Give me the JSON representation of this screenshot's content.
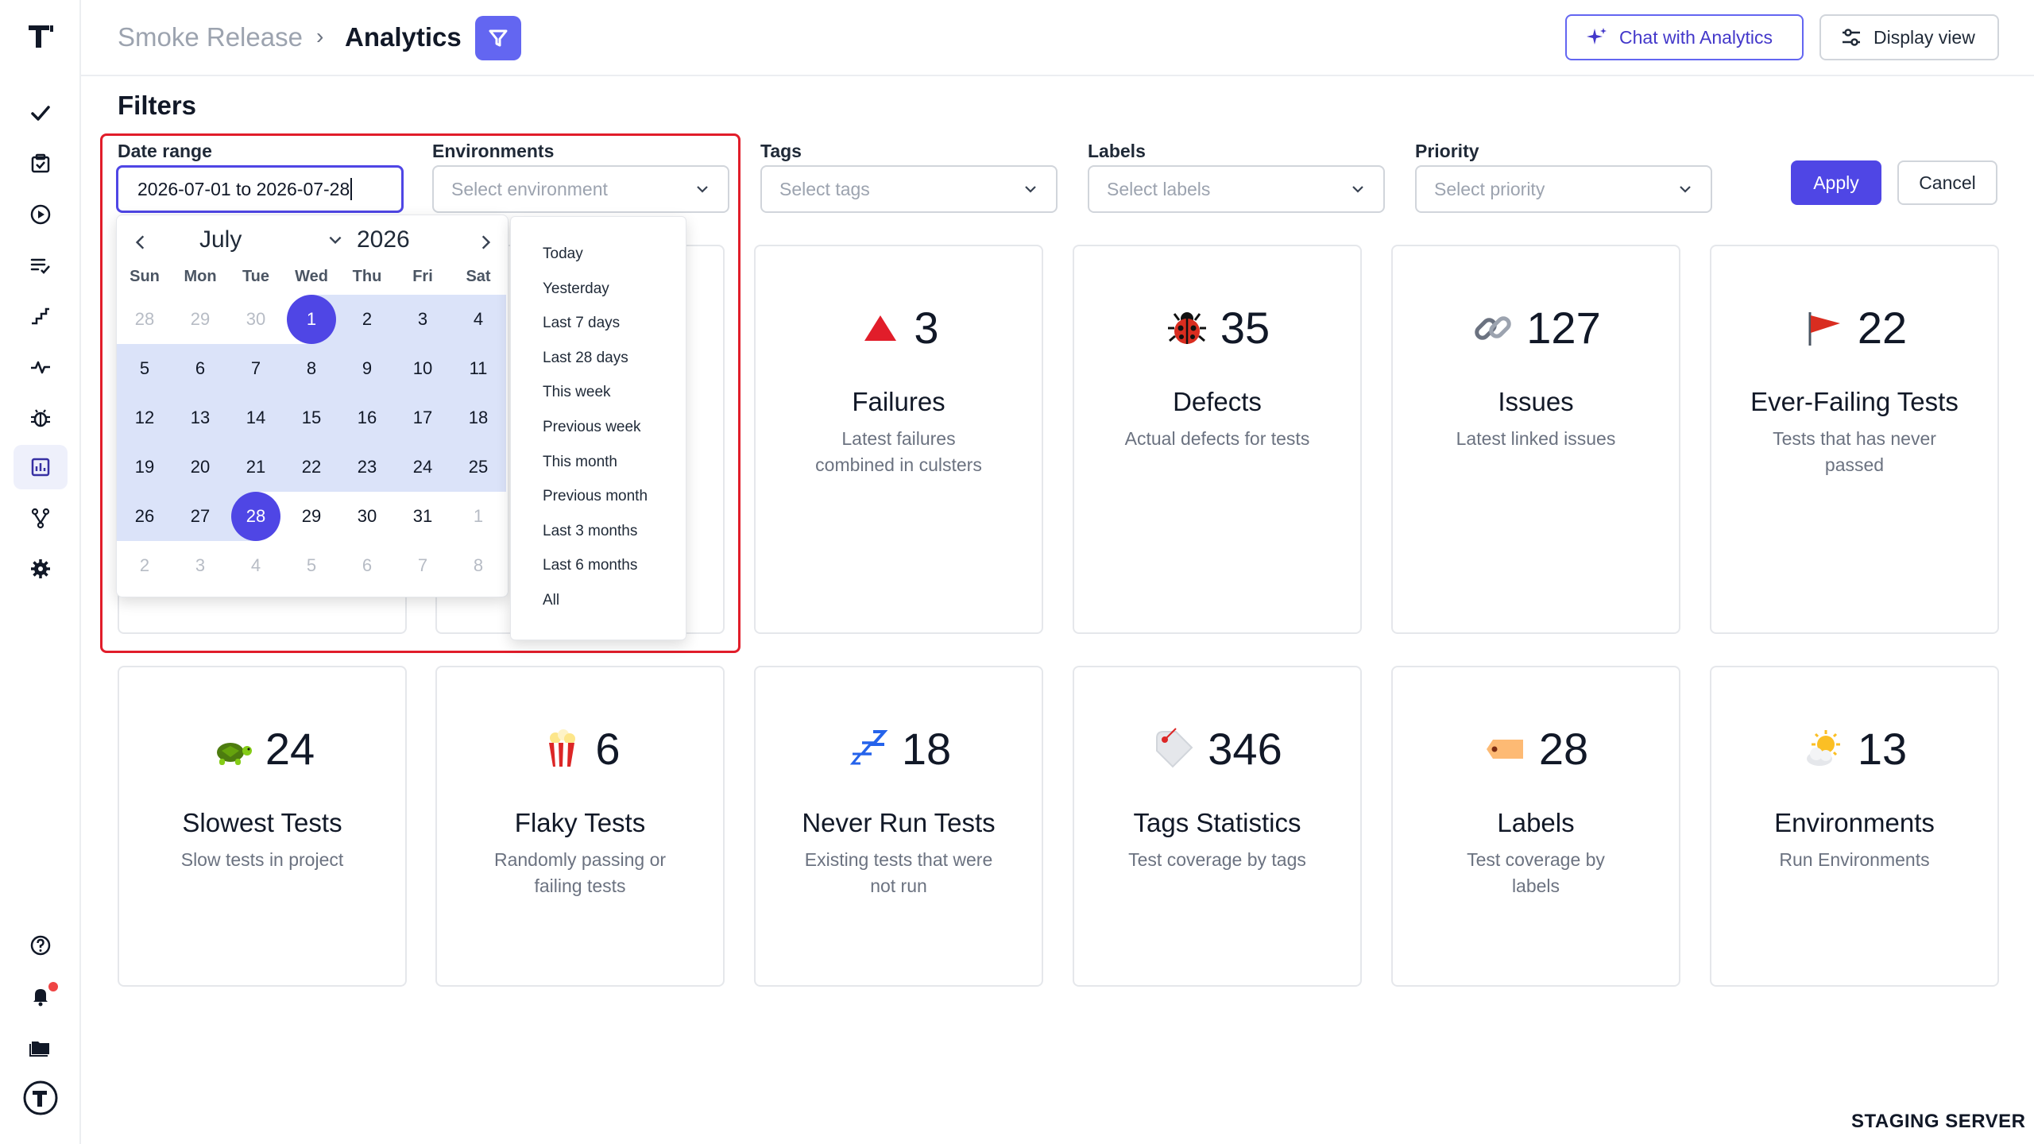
{
  "breadcrumb": {
    "project": "Smoke Release",
    "separator": "›",
    "page": "Analytics"
  },
  "header_buttons": {
    "chat": "Chat with Analytics",
    "display": "Display view"
  },
  "filters": {
    "title": "Filters",
    "date_range": {
      "label": "Date range",
      "value": "2026-07-01 to 2026-07-28"
    },
    "environments": {
      "label": "Environments",
      "placeholder": "Select environment"
    },
    "tags": {
      "label": "Tags",
      "placeholder": "Select tags"
    },
    "labels": {
      "label": "Labels",
      "placeholder": "Select labels"
    },
    "priority": {
      "label": "Priority",
      "placeholder": "Select priority"
    },
    "apply": "Apply",
    "cancel": "Cancel"
  },
  "datepicker": {
    "month": "July",
    "year": "2026",
    "weekdays": [
      "Sun",
      "Mon",
      "Tue",
      "Wed",
      "Thu",
      "Fri",
      "Sat"
    ],
    "weeks": [
      [
        "28",
        "29",
        "30",
        "1",
        "2",
        "3",
        "4"
      ],
      [
        "5",
        "6",
        "7",
        "8",
        "9",
        "10",
        "11"
      ],
      [
        "12",
        "13",
        "14",
        "15",
        "16",
        "17",
        "18"
      ],
      [
        "19",
        "20",
        "21",
        "22",
        "23",
        "24",
        "25"
      ],
      [
        "26",
        "27",
        "28",
        "29",
        "30",
        "31",
        "1"
      ],
      [
        "2",
        "3",
        "4",
        "5",
        "6",
        "7",
        "8"
      ]
    ],
    "range_start": "1",
    "range_end": "28",
    "presets": [
      "Today",
      "Yesterday",
      "Last 7 days",
      "Last 28 days",
      "This week",
      "Previous week",
      "This month",
      "Previous month",
      "Last 3 months",
      "Last 6 months",
      "All"
    ]
  },
  "cards": [
    {
      "value": "3",
      "title": "Failures",
      "desc": "Latest failures combined in culsters",
      "icon": "red-triangle-icon"
    },
    {
      "value": "35",
      "title": "Defects",
      "desc": "Actual defects for tests",
      "icon": "ladybug-icon"
    },
    {
      "value": "127",
      "title": "Issues",
      "desc": "Latest linked issues",
      "icon": "link-icon"
    },
    {
      "value": "22",
      "title": "Ever-Failing Tests",
      "desc": "Tests that has never passed",
      "icon": "red-flag-icon"
    },
    {
      "value": "24",
      "title": "Slowest Tests",
      "desc": "Slow tests in project",
      "icon": "turtle-icon"
    },
    {
      "value": "6",
      "title": "Flaky Tests",
      "desc": "Randomly passing or failing tests",
      "icon": "popcorn-icon"
    },
    {
      "value": "18",
      "title": "Never Run Tests",
      "desc": "Existing tests that were not run",
      "icon": "sleeping-zzz-icon"
    },
    {
      "value": "346",
      "title": "Tags Statistics",
      "desc": "Test coverage by tags",
      "icon": "tag-icon"
    },
    {
      "value": "28",
      "title": "Labels",
      "desc": "Test coverage by labels",
      "icon": "label-icon"
    },
    {
      "value": "13",
      "title": "Environments",
      "desc": "Run Environments",
      "icon": "sun-cloud-icon"
    }
  ],
  "footer": {
    "server": "STAGING SERVER"
  },
  "colors": {
    "accent": "#4f46e5",
    "highlight": "#e11d2a",
    "range": "#dbe3f9"
  }
}
